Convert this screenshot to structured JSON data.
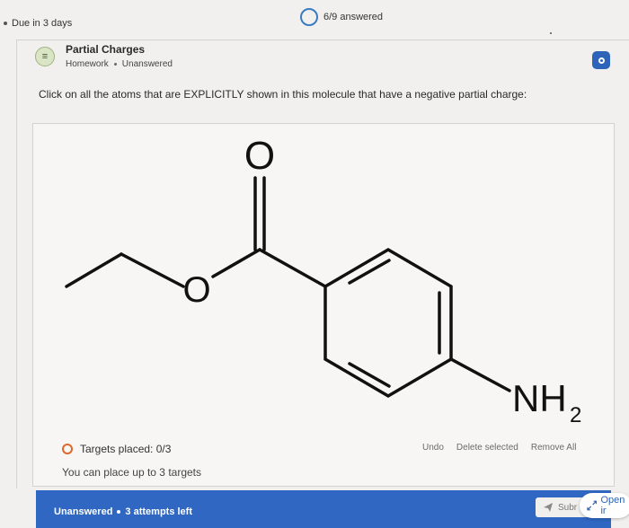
{
  "header": {
    "due_label": "Due in 3 days",
    "progress_label": "6/9 answered"
  },
  "question": {
    "icon_text": "≡",
    "title": "Partial Charges",
    "type": "Homework",
    "status": "Unanswered",
    "prompt": "Click on all the atoms that are EXPLICITLY shown in this molecule that have a negative partial charge:"
  },
  "molecule": {
    "carbonyl_oxygen": "O",
    "ether_oxygen": "O",
    "amine_group": "NH",
    "amine_subscript": "2"
  },
  "panel": {
    "targets_label": "Targets placed: 0/3",
    "limit_label": "You can place up to 3 targets",
    "undo_label": "Undo",
    "delete_label": "Delete selected",
    "remove_all_label": "Remove All"
  },
  "footer": {
    "status": "Unanswered",
    "attempts": "3 attempts left",
    "submit_label": "Subr",
    "open_label": "Open ir"
  },
  "colors": {
    "accent_blue": "#2f67c2",
    "target_orange": "#e0662b",
    "progress_ring": "#3b7bbf"
  }
}
